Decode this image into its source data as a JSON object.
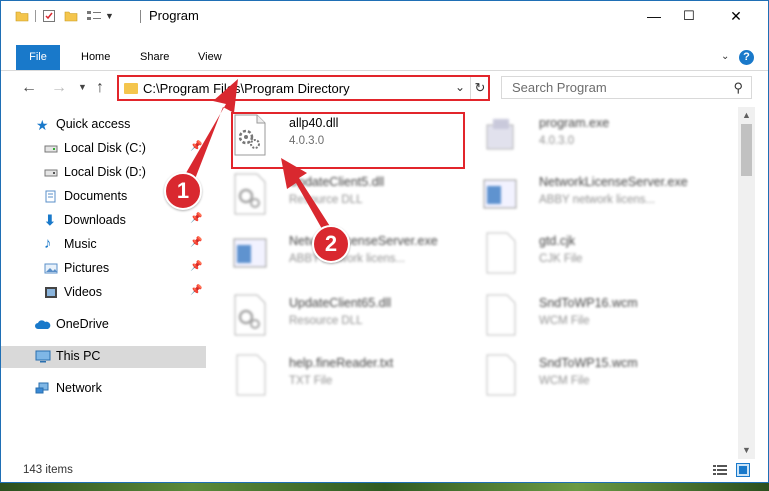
{
  "window": {
    "title": "Program",
    "controls": {
      "minimize": "—",
      "maximize": "☐",
      "close": "✕"
    }
  },
  "ribbon": {
    "tabs": [
      "File",
      "Home",
      "Share",
      "View"
    ],
    "help": "?"
  },
  "nav": {
    "address": "C:\\Program Files\\Program Directory",
    "search_placeholder": "Search Program"
  },
  "sidebar": {
    "items": [
      {
        "label": "Quick access",
        "icon": "star-icon",
        "pinned": false
      },
      {
        "label": "Local Disk (C:)",
        "icon": "drive-icon",
        "pinned": true
      },
      {
        "label": "Local Disk (D:)",
        "icon": "drive-icon",
        "pinned": false
      },
      {
        "label": "Documents",
        "icon": "documents-icon",
        "pinned": true
      },
      {
        "label": "Downloads",
        "icon": "download-icon",
        "pinned": true
      },
      {
        "label": "Music",
        "icon": "music-icon",
        "pinned": true
      },
      {
        "label": "Pictures",
        "icon": "pictures-icon",
        "pinned": true
      },
      {
        "label": "Videos",
        "icon": "video-icon",
        "pinned": true
      },
      {
        "label": "OneDrive",
        "icon": "cloud-icon",
        "pinned": false
      },
      {
        "label": "This PC",
        "icon": "computer-icon",
        "pinned": false,
        "selected": true
      },
      {
        "label": "Network",
        "icon": "network-icon",
        "pinned": false
      }
    ],
    "pin_glyph": "📌"
  },
  "files": [
    {
      "name": "allp40.dll",
      "sub": "4.0.3.0",
      "icon": "dll-gear-icon",
      "highlighted": true
    },
    {
      "name": "program.exe",
      "sub": "4.0.3.0",
      "icon": "exe-icon"
    },
    {
      "name": "UpdateClient5.dll",
      "sub": "Resource DLL",
      "icon": "dll-gear-icon"
    },
    {
      "name": "NetworkLicenseServer.exe",
      "sub": "ABBY network licens...",
      "icon": "app-window-icon"
    },
    {
      "name": "NetworkLicenseServer.exe",
      "sub": "ABBY network licens...",
      "icon": "app-window-icon"
    },
    {
      "name": "gtd.cjk",
      "sub": "CJK File",
      "icon": "blank-file-icon"
    },
    {
      "name": "UpdateClient65.dll",
      "sub": "Resource DLL",
      "icon": "dll-gear-icon"
    },
    {
      "name": "SndToWP16.wcm",
      "sub": "WCM File",
      "icon": "blank-file-icon"
    },
    {
      "name": "help.fineReader.txt",
      "sub": "TXT File",
      "icon": "blank-file-icon"
    },
    {
      "name": "SndToWP15.wcm",
      "sub": "WCM File",
      "icon": "blank-file-icon"
    }
  ],
  "status": {
    "count": "143 items"
  },
  "annotations": {
    "step1": "1",
    "step2": "2",
    "color": "#d9282f"
  },
  "colors": {
    "accent": "#1979ca",
    "highlight_border": "#e2252b"
  }
}
